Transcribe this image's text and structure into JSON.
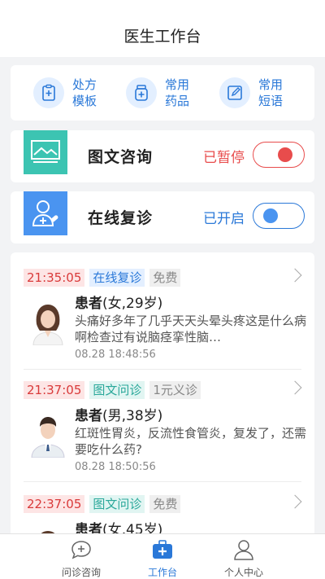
{
  "header": {
    "title": "医生工作台"
  },
  "quick": [
    {
      "label": "处方模板",
      "icon": "prescription-template-icon"
    },
    {
      "label": "常用药品",
      "icon": "medicine-bottle-icon"
    },
    {
      "label": "常用短语",
      "icon": "edit-phrase-icon"
    }
  ],
  "switches": [
    {
      "name": "图文咨询",
      "state": "已暂停",
      "state_color": "#e84c4c",
      "icon": "image-text-consult-icon",
      "knob_color": "#e84c4c"
    },
    {
      "name": "在线复诊",
      "state": "已开启",
      "state_color": "#2a78d8",
      "icon": "online-revisit-icon",
      "knob_color": "#2a78d8"
    }
  ],
  "consults": [
    {
      "time": "21:35:05",
      "type": "在线复诊",
      "fee": "免费",
      "patient_prefix": "患者",
      "patient_info": "(女,29岁)",
      "desc": "头痛好多年了几乎天天头晕头疼这是什么病啊检查过有说脑痉挛性脑…",
      "date": "08.28 18:48:56",
      "gender": "female"
    },
    {
      "time": "21:37:05",
      "type": "图文问诊",
      "fee": "1元义诊",
      "patient_prefix": "患者",
      "patient_info": "(男,38岁)",
      "desc": "红斑性胃炎，反流性食管炎，复发了，还需要吃什么药?",
      "date": "08.28 18:50:56",
      "gender": "male"
    },
    {
      "time": "22:37:05",
      "type": "图文问诊",
      "fee": "免费",
      "patient_prefix": "患者",
      "patient_info": "(女,45岁)",
      "desc": "",
      "date": "",
      "gender": "female"
    }
  ],
  "tabs": [
    {
      "label": "问诊咨询",
      "icon": "chat-consult-icon",
      "active": false
    },
    {
      "label": "工作台",
      "icon": "workbench-icon",
      "active": true
    },
    {
      "label": "个人中心",
      "icon": "person-icon",
      "active": false
    }
  ],
  "colors": {
    "accent": "#2a78d8",
    "paused": "#e84c4c",
    "teal": "#3cc4b2"
  }
}
